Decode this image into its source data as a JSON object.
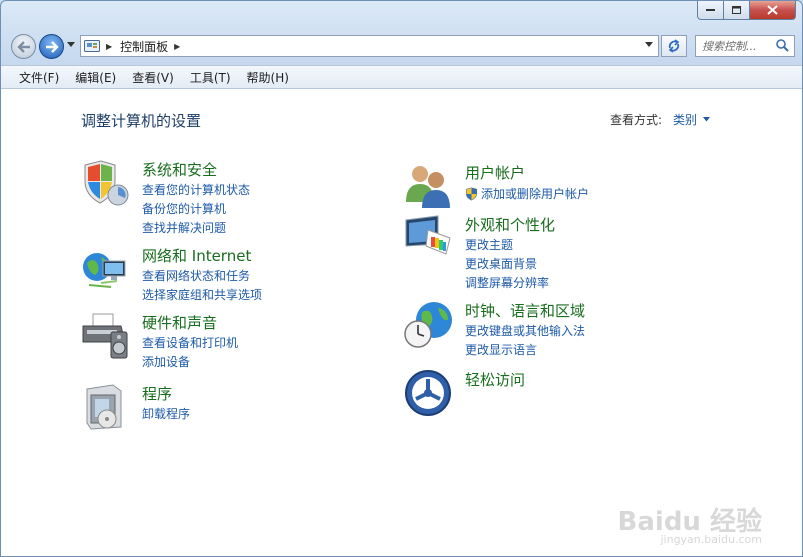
{
  "window": {
    "caption_buttons": [
      "minimize-icon",
      "maximize-icon",
      "close-icon"
    ]
  },
  "address": {
    "crumb": "控制面板",
    "search_placeholder": "搜索控制..."
  },
  "menu": [
    "文件(F)",
    "编辑(E)",
    "查看(V)",
    "工具(T)",
    "帮助(H)"
  ],
  "main": {
    "title": "调整计算机的设置",
    "view_by_label": "查看方式:",
    "view_by_value": "类别"
  },
  "left_categories": [
    {
      "head": "系统和安全",
      "links": [
        "查看您的计算机状态",
        "备份您的计算机",
        "查找并解决问题"
      ]
    },
    {
      "head": "网络和 Internet",
      "links": [
        "查看网络状态和任务",
        "选择家庭组和共享选项"
      ]
    },
    {
      "head": "硬件和声音",
      "links": [
        "查看设备和打印机",
        "添加设备"
      ]
    },
    {
      "head": "程序",
      "links": [
        "卸载程序"
      ]
    }
  ],
  "right_categories": [
    {
      "head": "用户帐户",
      "links": [
        "添加或删除用户帐户"
      ]
    },
    {
      "head": "外观和个性化",
      "links": [
        "更改主题",
        "更改桌面背景",
        "调整屏幕分辨率"
      ]
    },
    {
      "head": "时钟、语言和区域",
      "links": [
        "更改键盘或其他输入法",
        "更改显示语言"
      ]
    },
    {
      "head": "轻松访问",
      "links": []
    }
  ],
  "watermark": {
    "main": "Baidu 经验",
    "sub": "jingyan.baidu.com"
  }
}
